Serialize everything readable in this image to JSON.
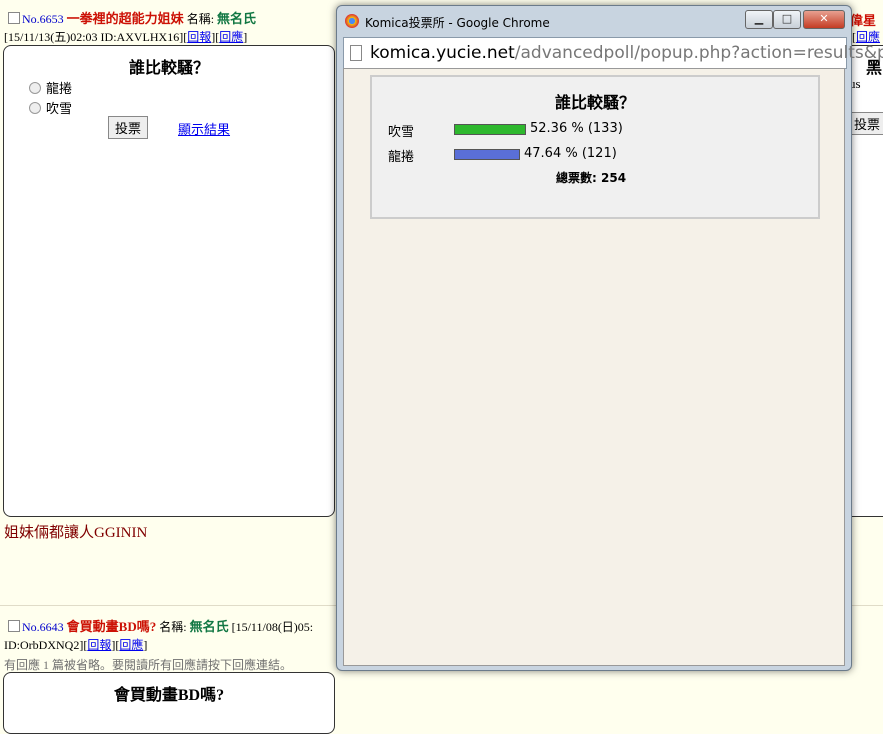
{
  "post1": {
    "no": "No.6653",
    "title": "一拳裡的超能力姐妹",
    "name_label": "名稱:",
    "name": "無名氏",
    "datetime": "[15/11/13(五)02:03 ID:AXVLHX16]",
    "report": "回報",
    "reply": "回應",
    "poll": {
      "title": "誰比較騷？",
      "options": [
        "龍捲",
        "吹雪"
      ],
      "vote_button": "投票",
      "show_results": "顯示結果"
    },
    "comment": "姐妹倆都讓人GGININ"
  },
  "right_partial": {
    "title_fragment": "偉星",
    "reply": "回應",
    "poll_title_fragment": "黑",
    "option_fragment": "us",
    "vote_fragment": "投票"
  },
  "post2": {
    "no": "No.6643",
    "title": "會買動畫BD嗎?",
    "name_label": "名稱:",
    "name": "無名氏",
    "datetime": "[15/11/08(日)05:",
    "id": "ID:OrbDXNQ2]",
    "report": "回報",
    "reply": "回應",
    "omitted": "有回應 1 篇被省略。要閱讀所有回應請按下回應連結。",
    "poll_title": "會買動畫BD嗎?"
  },
  "popup": {
    "window_title": "Komica投票所 - Google Chrome",
    "url_host": "komica.yucie.net",
    "url_path": "/advancedpoll/popup.php?action=results&pc",
    "results": {
      "title": "誰比較騷？",
      "rows": [
        {
          "label": "吹雪",
          "percent_text": "52.36 % (133)",
          "percent": 52.36,
          "count": 133,
          "color": "#2EB82E"
        },
        {
          "label": "龍捲",
          "percent_text": "47.64 % (121)",
          "percent": 47.64,
          "count": 121,
          "color": "#5A6FD8"
        }
      ],
      "total_label": "總票數:",
      "total": "254"
    }
  }
}
